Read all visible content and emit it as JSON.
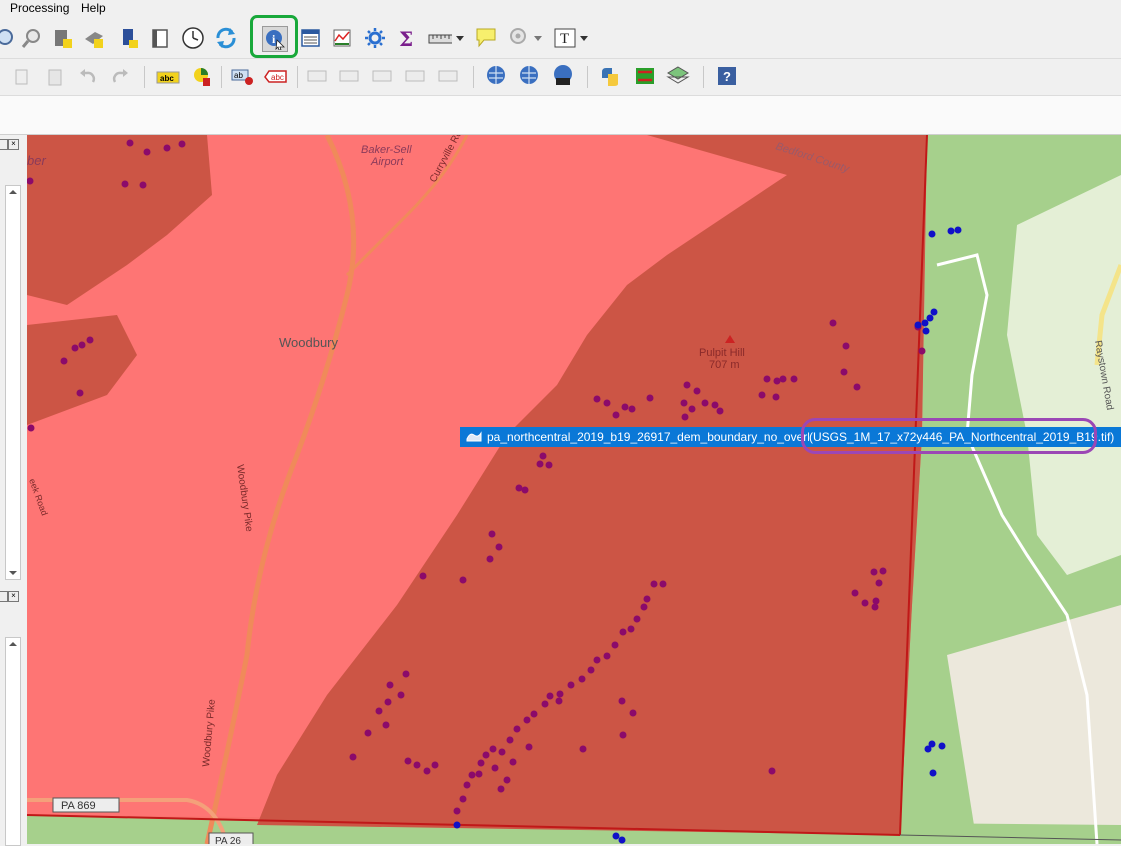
{
  "menubar": {
    "items": [
      {
        "label": "Processing"
      },
      {
        "label": "Help"
      }
    ]
  },
  "toolbar1": {
    "tools": [
      "zoom-layer-icon",
      "zoom-selection-icon",
      "new-bookmark-icon",
      "show-bookmarks-icon",
      "temporal-controller-icon",
      "refresh-icon",
      "identify-features-icon",
      "attribute-table-icon",
      "statistics-icon",
      "processing-toolbox-icon",
      "sum-icon",
      "measure-icon",
      "map-tips-icon",
      "show-map-tips-icon",
      "text-annotation-icon"
    ]
  },
  "map": {
    "labels": {
      "town": "Woodbury",
      "airport_line1": "Baker-Sell",
      "airport_line2": "Airport",
      "peak_name": "Pulpit Hill",
      "peak_elev": "707 m",
      "route": "PA 869",
      "route2": "PA 26",
      "road1": "Woodbury Pike",
      "road2": "Woodbury Pike",
      "road3": "Curryville Road",
      "road4": "Raystown Road",
      "county": "Bedford County",
      "edge_left": "ber",
      "road_left": "eek Road"
    },
    "colors": {
      "layer_fill": "#ff5a5a",
      "forest_fill": "#cc5544",
      "point_inside": "#8b0a6a",
      "point_outside": "#1010c8",
      "boundary": "#c01818"
    }
  },
  "identify_popup": {
    "layer_name": "pa_northcentral_2019_b19_26917_dem_boundary_no_overlap",
    "value": "(USGS_1M_17_x72y446_PA_Northcentral_2019_B19.tif)"
  }
}
